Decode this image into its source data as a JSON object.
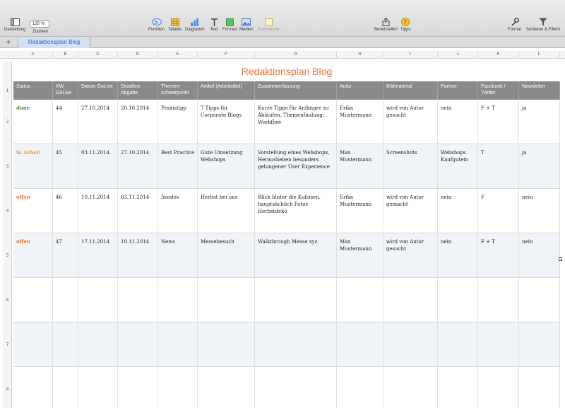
{
  "toolbar": {
    "left": [
      {
        "label": "Darstellung",
        "icon": "sidebar-icon"
      }
    ],
    "zoom": {
      "value": "125 %",
      "label": "Zoomen"
    },
    "insert": [
      {
        "label": "Funktion",
        "icon": "function-icon"
      },
      {
        "label": "Tabelle",
        "icon": "table-icon"
      },
      {
        "label": "Diagramm",
        "icon": "chart-icon"
      },
      {
        "label": "Text",
        "icon": "text-icon"
      },
      {
        "label": "Formen",
        "icon": "shape-icon"
      },
      {
        "label": "Medien",
        "icon": "media-icon"
      },
      {
        "label": "Kommentar",
        "icon": "comment-icon"
      }
    ],
    "share": [
      {
        "label": "Bereitstellen",
        "icon": "share-icon"
      },
      {
        "label": "Tipps",
        "icon": "tips-icon"
      }
    ],
    "right": [
      {
        "label": "Format",
        "icon": "format-icon"
      },
      {
        "label": "Sortieren & Filtern",
        "icon": "filter-icon"
      }
    ]
  },
  "sheet_tab": "Redaktionsplan Blog",
  "column_letters": [
    "A",
    "B",
    "C",
    "D",
    "E",
    "F",
    "G",
    "H",
    "I",
    "J",
    "K",
    "L"
  ],
  "row_numbers": [
    "1",
    "2",
    "3",
    "4",
    "5",
    "6",
    "7",
    "8"
  ],
  "table": {
    "title": "Redaktionsplan Blog",
    "headers": [
      "Status",
      "KW GoLive",
      "Datum GoLive",
      "Deadline Abgabe",
      "Themen-schwerpunkt",
      "Artikel (Arbeitstitel)",
      "Zusammenfassung",
      "Autor",
      "Bildmaterial",
      "Partner",
      "Facebook / Twitter",
      "Newsletter"
    ],
    "rows": [
      [
        "done",
        "44",
        "27.10.2014",
        "20.10.2014",
        "Praxistipp",
        "7 Tipps für Corporate Blogs",
        "Kurze Tipps für Anfänger zu Abläufen, Themenfindung, Workflow",
        "Erika Mustermann",
        "wird von Autor gesucht",
        "nein",
        "F + T",
        "ja"
      ],
      [
        "in Arbeit",
        "45",
        "03.11.2014",
        "27.10.2014",
        "Best Practice",
        "Gute Umsetzung Webshops",
        "Vorstellung eines Webshops, Herausheben besonders gelungener User Experience",
        "Max Mustermann",
        "Screenshots",
        "Webshops Kaufgutein",
        "T",
        "ja"
      ],
      [
        "offen",
        "46",
        "10.11.2014",
        "03.11.2014",
        "Insides",
        "Herbst bei uns",
        "Blick hinter die Kulissen, hauptsächlich Fotos Herbstdeko",
        "Erika Mustermann",
        "wird von Autor gemacht",
        "nein",
        "F",
        "nein"
      ],
      [
        "offen",
        "47",
        "17.11.2014",
        "10.11.2014",
        "News",
        "Messebesuch",
        "Walkthrough Messe xyz",
        "Max Mustermann",
        "wird von Autor gesucht",
        "nein",
        "F + T",
        "nein"
      ],
      [
        "",
        "",
        "",
        "",
        "",
        "",
        "",
        "",
        "",
        "",
        "",
        ""
      ],
      [
        "",
        "",
        "",
        "",
        "",
        "",
        "",
        "",
        "",
        "",
        "",
        ""
      ],
      [
        "",
        "",
        "",
        "",
        "",
        "",
        "",
        "",
        "",
        "",
        "",
        ""
      ]
    ]
  },
  "colors": {
    "accent": "#e8733a",
    "done": "#4f9a28",
    "in_arbeit": "#f0a030",
    "offen": "#e8733a",
    "header_bg": "#8a8a8a"
  }
}
